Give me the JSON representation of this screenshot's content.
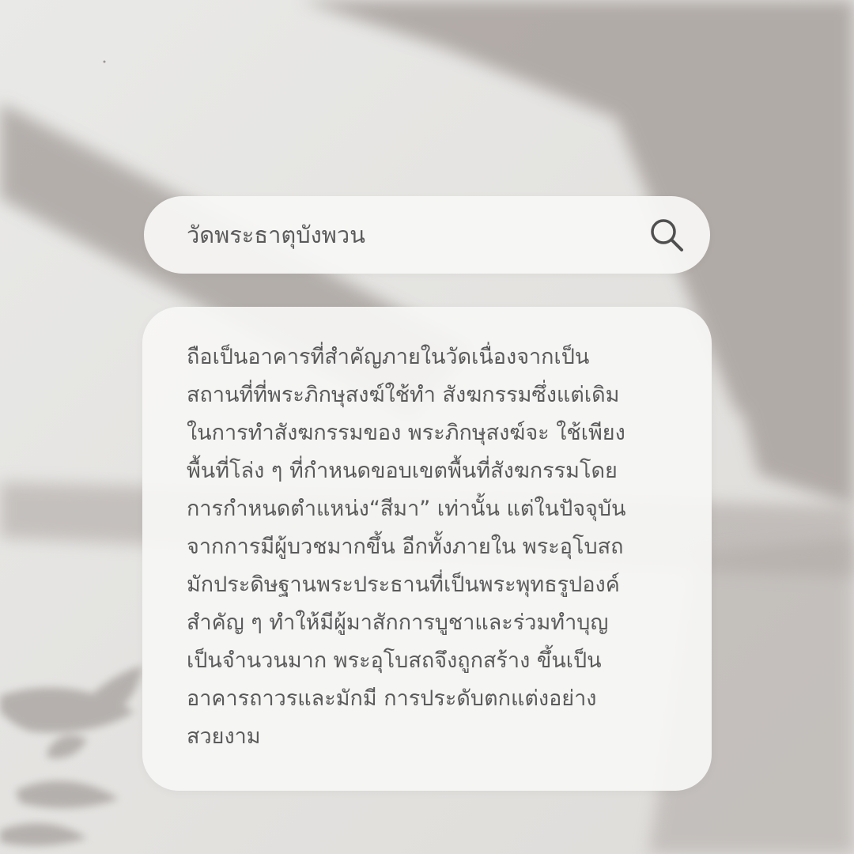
{
  "search": {
    "query": "วัดพระธาตุบังพวน",
    "icon": "search-icon"
  },
  "article": {
    "lines": [
      "ถือเป็นอาคารที่สำคัญภายในวัดเนื่องจากเป็น",
      "สถานที่ที่พระภิกษุสงฆ์ใช้ทำ สังฆกรรมซึ่งแต่เดิม",
      "ในการทำสังฆกรรมของ พระภิกษุสงฆ์จะ ใช้เพียง",
      "พื้นที่โล่ง ๆ ที่กำหนดขอบเขตพื้นที่สังฆกรรมโดย",
      "การกำหนดตำแหน่ง“สีมา” เท่านั้น แต่ในปัจจุบัน",
      "จากการมีผู้บวชมากขึ้น อีกทั้งภายใน พระอุโบสถ",
      "มักประดิษฐานพระประธานที่เป็นพระพุทธรูปองค์",
      "สำคัญ ๆ ทำให้มีผู้มาสักการบูชาและร่วมทำบุญ",
      "เป็นจำนวนมาก พระอุโบสถจึงถูกสร้าง ขึ้นเป็น",
      "อาคารถาวรและมักมี การประดับตกแต่งอย่าง",
      "สวยงาม"
    ]
  },
  "colors": {
    "text": "#5a5a5a",
    "panel": "#f6f6f5",
    "background": "#e4e3e1",
    "shadow": "#a9a29e"
  }
}
